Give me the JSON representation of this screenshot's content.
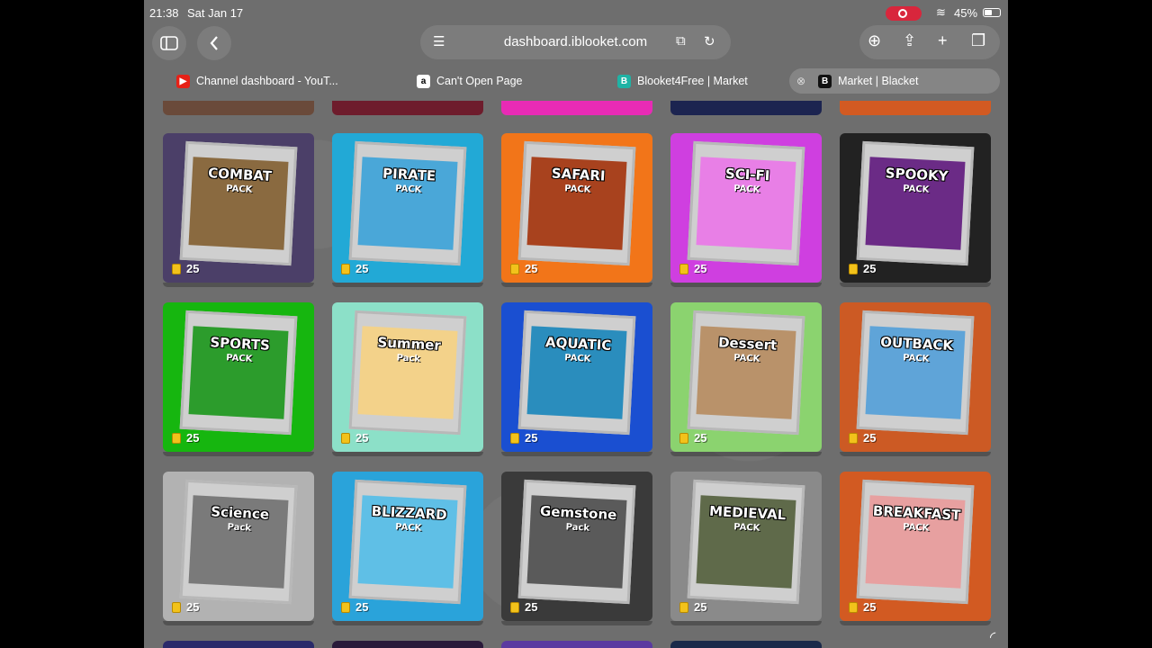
{
  "status": {
    "time": "21:38",
    "date": "Sat Jan 17",
    "battery": "45%"
  },
  "url": {
    "domain": "dashboard.iblooket.com"
  },
  "tabs": [
    {
      "label": "Channel dashboard - YouT...",
      "favicon": "youtube-icon",
      "color": "#e62117",
      "fav_text": ""
    },
    {
      "label": "Can't Open Page",
      "favicon": "amazon-icon",
      "color": "#ffffff",
      "fav_text": "a"
    },
    {
      "label": "Blooket4Free | Market",
      "favicon": "blooket-icon",
      "color": "#1fb3a5",
      "fav_text": "B"
    },
    {
      "label": "Market | Blacket",
      "favicon": "blacket-icon",
      "color": "#111111",
      "fav_text": "B",
      "active": true
    }
  ],
  "packs": [
    {
      "name": "COMBAT",
      "sub": "PACK",
      "price": "25",
      "bg": "#4b3f68",
      "art": "#8a6a40"
    },
    {
      "name": "PIRATE",
      "sub": "PACK",
      "price": "25",
      "bg": "#22a9d6",
      "art": "#4aa7d8"
    },
    {
      "name": "SAFARI",
      "sub": "PACK",
      "price": "25",
      "bg": "#f27519",
      "art": "#a8421e"
    },
    {
      "name": "SCI-FI",
      "sub": "PACK",
      "price": "25",
      "bg": "#cf3fe0",
      "art": "#e87fe6"
    },
    {
      "name": "SPOOKY",
      "sub": "PACK",
      "price": "25",
      "bg": "#222222",
      "art": "#6b2b86"
    },
    {
      "name": "SPORTS",
      "sub": "PACK",
      "price": "25",
      "bg": "#16b60f",
      "art": "#2c9c2c"
    },
    {
      "name": "Summer",
      "sub": "Pack",
      "price": "25",
      "bg": "#8ce0c8",
      "art": "#f3d28a"
    },
    {
      "name": "AQUATIC",
      "sub": "PACK",
      "price": "25",
      "bg": "#1a4fd1",
      "art": "#2a8dbd"
    },
    {
      "name": "Dessert",
      "sub": "PACK",
      "price": "25",
      "bg": "#8bd36f",
      "art": "#b9926a"
    },
    {
      "name": "OUTBACK",
      "sub": "PACK",
      "price": "25",
      "bg": "#cc5a24",
      "art": "#5fa4d8"
    },
    {
      "name": "Science",
      "sub": "Pack",
      "price": "25",
      "bg": "#b2b2b2",
      "art": "#7a7a7a"
    },
    {
      "name": "BLIZZARD",
      "sub": "PACK",
      "price": "25",
      "bg": "#2aa3da",
      "art": "#5fbfe6"
    },
    {
      "name": "Gemstone",
      "sub": "Pack",
      "price": "25",
      "bg": "#3a3a3a",
      "art": "#5a5a5a"
    },
    {
      "name": "MEDIEVAL",
      "sub": "PACK",
      "price": "25",
      "bg": "#8a8a8a",
      "art": "#5f6a4a"
    },
    {
      "name": "BREAKFAST",
      "sub": "PACK",
      "price": "25",
      "bg": "#d25a22",
      "art": "#e7a0a0"
    }
  ],
  "top_strips": [
    "#6a4a3a",
    "#6e1c2c",
    "#e82bb5",
    "#1c2450",
    "#d25a22"
  ],
  "bottom_strips": [
    "#2a2a6a",
    "#2a1a3a",
    "#5a3aa0",
    "#1a2a4a"
  ]
}
